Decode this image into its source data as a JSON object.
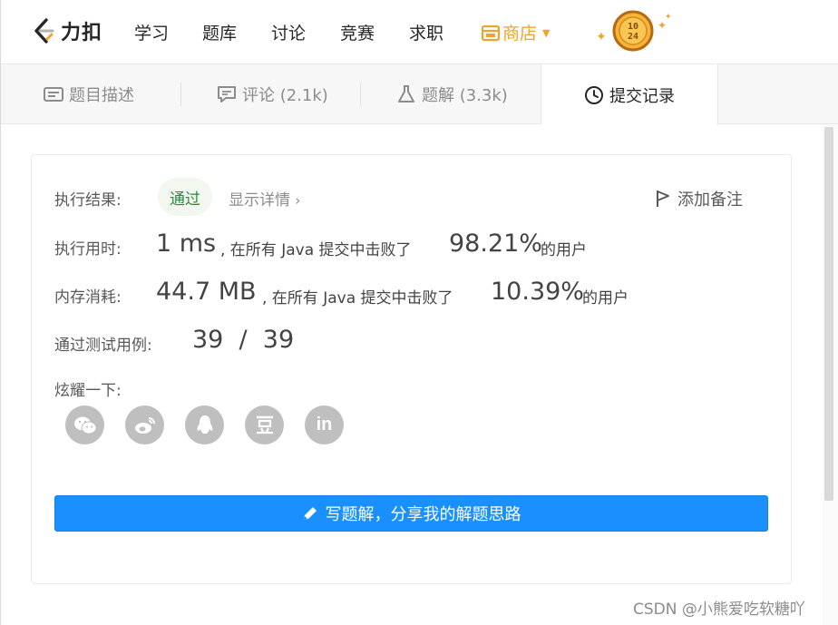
{
  "nav": {
    "logo_text": "力扣",
    "items": [
      "学习",
      "题库",
      "讨论",
      "竞赛",
      "求职"
    ],
    "shop_label": "商店",
    "coin_text_top": "10",
    "coin_text_bottom": "24"
  },
  "tabs": {
    "description": "题目描述",
    "comments": "评论 (2.1k)",
    "solutions": "题解 (3.3k)",
    "submissions": "提交记录"
  },
  "result": {
    "label": "执行结果:",
    "status": "通过",
    "show_detail": "显示详情",
    "add_note": "添加备注",
    "runtime_label": "执行用时:",
    "runtime_value": "1 ms",
    "runtime_text": ", 在所有 Java 提交中击败了",
    "runtime_percent": "98.21%",
    "runtime_suffix": "的用户",
    "memory_label": "内存消耗:",
    "memory_value": "44.7 MB",
    "memory_text": ", 在所有 Java 提交中击败了",
    "memory_percent": "10.39%",
    "memory_suffix": "的用户",
    "tests_label": "通过测试用例:",
    "tests_value": "39  /  39",
    "share_label": "炫耀一下:"
  },
  "share_icons": [
    "wechat-icon",
    "weibo-icon",
    "qq-icon",
    "douban-icon",
    "linkedin-icon"
  ],
  "write_button": "写题解，分享我的解题思路",
  "watermark": "CSDN @小熊爱吃软糖吖",
  "colors": {
    "accent": "#1a90ff",
    "shop": "#f0a32f",
    "pass": "#2d8a3e",
    "pass_bg": "#f2f8f0"
  }
}
